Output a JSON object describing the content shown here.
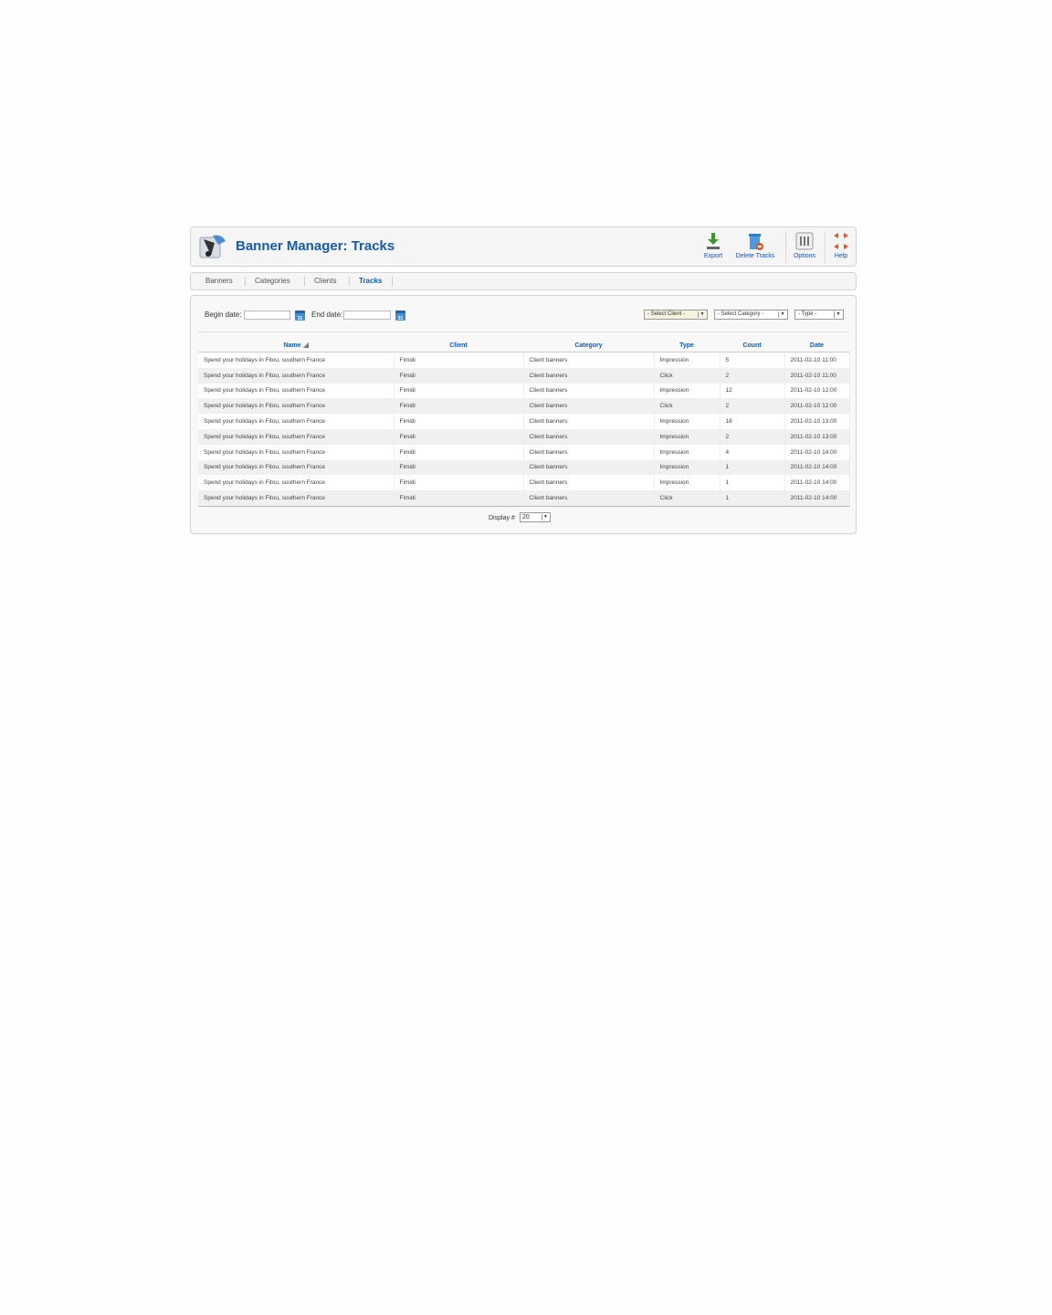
{
  "header": {
    "title": "Banner Manager: Tracks",
    "logo_icon": "banner-manager-logo-icon",
    "buttons": [
      {
        "label": "Export",
        "icon": "download-icon"
      },
      {
        "label": "Delete Tracks",
        "icon": "delete-trash-icon"
      },
      {
        "label": "Options",
        "icon": "options-icon"
      },
      {
        "label": "Help",
        "icon": "help-lifebuoy-icon"
      }
    ]
  },
  "tabs": [
    {
      "label": "Banners",
      "active": false
    },
    {
      "label": "Categories",
      "active": false
    },
    {
      "label": "Clients",
      "active": false
    },
    {
      "label": "Tracks",
      "active": true
    }
  ],
  "filters": {
    "begin_date_label": "Begin date:",
    "begin_date_value": "",
    "end_date_label": "End date:",
    "end_date_value": "",
    "calendar_label": "31",
    "client_select": "- Select Client -",
    "category_select": "- Select Category -",
    "type_select": "- Type -"
  },
  "table": {
    "columns": [
      "Name",
      "Client",
      "Category",
      "Type",
      "Count",
      "Date"
    ],
    "rows": [
      [
        "Spend your holidays in Fitou, southern France",
        "Fimidi",
        "Client banners",
        "Impression",
        "5",
        "2011-02-10 11:00"
      ],
      [
        "Spend your holidays in Fitou, southern France",
        "Fimidi",
        "Client banners",
        "Click",
        "2",
        "2011-02-10 11:00"
      ],
      [
        "Spend your holidays in Fitou, southern France",
        "Fimidi",
        "Client banners",
        "Impression",
        "12",
        "2011-02-10 12:00"
      ],
      [
        "Spend your holidays in Fitou, southern France",
        "Fimidi",
        "Client banners",
        "Click",
        "2",
        "2011-02-10 12:00"
      ],
      [
        "Spend your holidays in Fitou, southern France",
        "Fimidi",
        "Client banners",
        "Impression",
        "18",
        "2011-02-10 13:00"
      ],
      [
        "Spend your holidays in Fitou, southern France",
        "Fimidi",
        "Client banners",
        "Impression",
        "2",
        "2011-02-10 13:00"
      ],
      [
        "Spend your holidays in Fitou, southern France",
        "Fimidi",
        "Client banners",
        "Impression",
        "4",
        "2011-02-10 14:00"
      ],
      [
        "Spend your holidays in Fitou, southern France",
        "Fimidi",
        "Client banners",
        "Impression",
        "1",
        "2011-02-10 14:00"
      ],
      [
        "Spend your holidays in Fitou, southern France",
        "Fimidi",
        "Client banners",
        "Impression",
        "1",
        "2011-02-10 14:00"
      ],
      [
        "Spend your holidays in Fitou, southern France",
        "Fimidi",
        "Client banners",
        "Click",
        "1",
        "2011-02-10 14:00"
      ]
    ]
  },
  "pagination": {
    "display_label": "Display #",
    "display_value": "20"
  },
  "colors": {
    "title": "#135cae",
    "link": "#0b55c4",
    "help": "#e0572a",
    "export": "#3a9a2a"
  }
}
